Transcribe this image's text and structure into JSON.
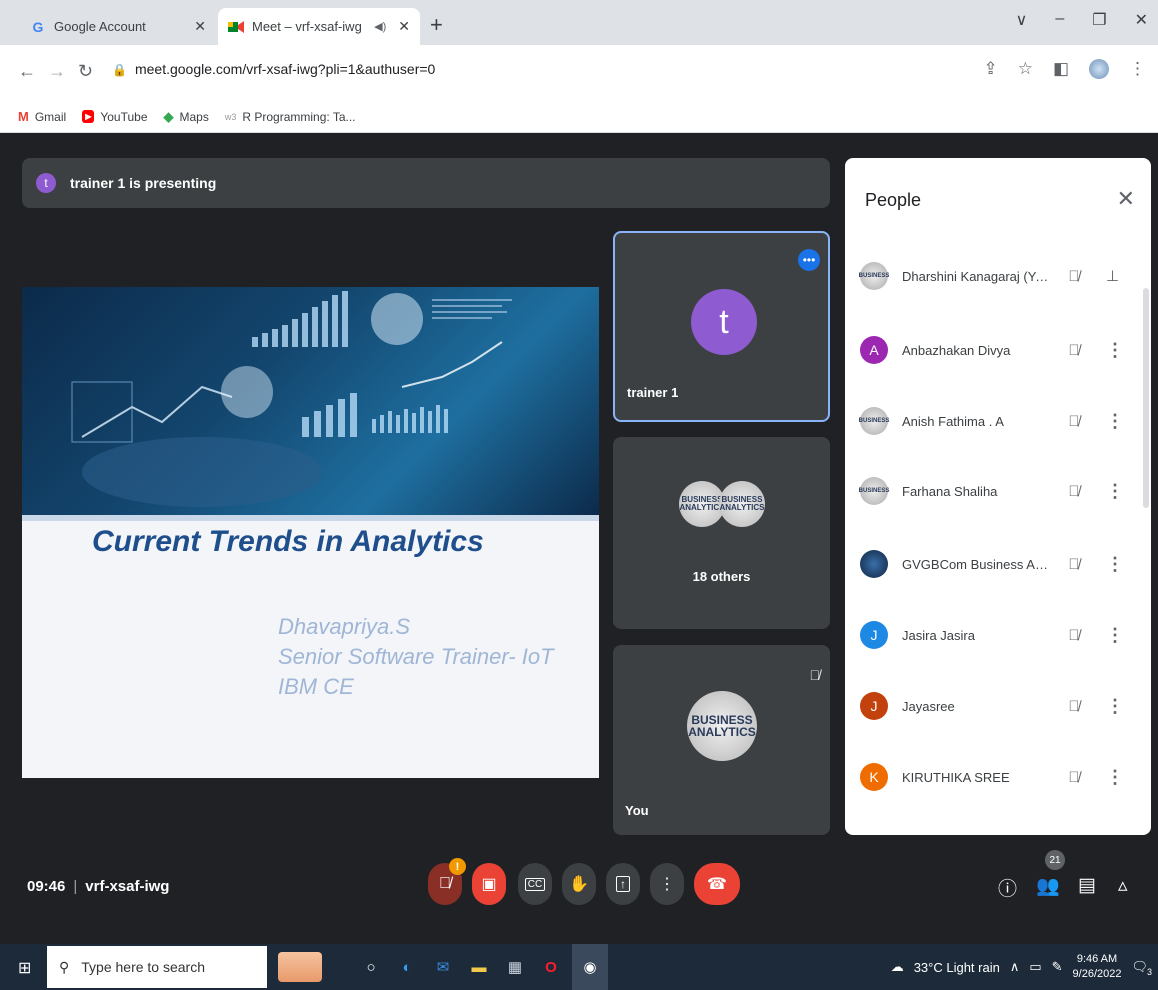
{
  "browser": {
    "tabs": [
      {
        "label": "Google Account",
        "icon": "google-icon"
      },
      {
        "label": "Meet – vrf-xsaf-iwg",
        "icon": "meet-icon"
      }
    ],
    "url": "meet.google.com/vrf-xsaf-iwg?pli=1&authuser=0",
    "bookmarks": [
      {
        "label": "Gmail",
        "icon": "gmail-icon"
      },
      {
        "label": "YouTube",
        "icon": "youtube-icon"
      },
      {
        "label": "Maps",
        "icon": "maps-icon"
      },
      {
        "label": "R Programming: Ta...",
        "icon": "w3schools-icon"
      }
    ]
  },
  "meet": {
    "presenting": {
      "avatar": "t",
      "text": "trainer 1 is presenting"
    },
    "slide": {
      "title": "Current  Trends in Analytics",
      "presenter": "Dhavapriya.S",
      "role": "Senior Software Trainer- IoT",
      "org": "IBM CE"
    },
    "tiles": {
      "trainer": {
        "avatar": "t",
        "name": "trainer 1"
      },
      "others": {
        "label": "18 others"
      },
      "you": {
        "name": "You"
      }
    },
    "meeting_time": "09:46",
    "meeting_code": "vrf-xsaf-iwg",
    "participant_count": "21",
    "colors": {
      "accent": "#1a73e8",
      "end_call": "#ea4335",
      "avatar_purple": "#8e5bd1"
    }
  },
  "people": {
    "title": "People",
    "list": [
      {
        "name": "Dharshini Kanagaraj (You)",
        "avatar": "",
        "avatar_type": "biz"
      },
      {
        "name": "Anbazhakan Divya",
        "avatar": "A",
        "avatar_color": "#9c27b0"
      },
      {
        "name": "Anish Fathima . A",
        "avatar": "",
        "avatar_type": "biz"
      },
      {
        "name": "Farhana Shaliha",
        "avatar": "",
        "avatar_type": "biz"
      },
      {
        "name": "GVGBCom Business Anal...",
        "avatar": "",
        "avatar_type": "globe"
      },
      {
        "name": "Jasira Jasira",
        "avatar": "J",
        "avatar_color": "#1e88e5"
      },
      {
        "name": "Jayasree",
        "avatar": "J",
        "avatar_color": "#c2410c"
      },
      {
        "name": "KIRUTHIKA SREE",
        "avatar": "K",
        "avatar_color": "#ef6c00"
      }
    ]
  },
  "taskbar": {
    "search_placeholder": "Type here to search",
    "weather": "33°C  Light rain",
    "time": "9:46 AM",
    "date": "9/26/2022",
    "notifications": "3"
  }
}
